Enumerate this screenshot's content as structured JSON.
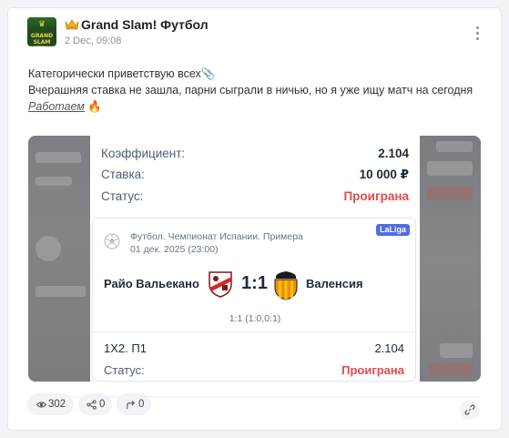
{
  "channel": {
    "name": "Grand Slam! Футбол",
    "date": "2 Dec, 09:08",
    "avatar_text": "GRAND SLAM BETTING"
  },
  "post": {
    "line1": "Категорически приветствую всех📎",
    "line2": "Вчерашняя ставка не зашла, парни сыграли в ничью, но я уже ищу матч на сегодня",
    "line3": "Работаем",
    "line3_emoji": "🔥"
  },
  "slip": {
    "coef_label": "Коэффициент:",
    "coef_value": "2.104",
    "stake_label": "Ставка:",
    "stake_value": "10 000 ₽",
    "status_label": "Статус:",
    "status_value": "Проиграна"
  },
  "match": {
    "league": "Футбол. Чемпионат Испании. Примера",
    "datetime": "01 дек. 2025 (23:00)",
    "badge": "LaLiga",
    "home": "Райо Вальекано",
    "away": "Валенсия",
    "score": "1:1",
    "score_detail": "1:1 (1:0,0:1)",
    "market": "1X2. П1",
    "market_coef": "2.104",
    "status_label": "Статус:",
    "status_value": "Проиграна"
  },
  "footer": {
    "views": "302",
    "shares": "0",
    "forwards": "0"
  },
  "colors": {
    "lost": "#e5484d",
    "badge": "#4d6ce6",
    "label": "#4b5d76"
  }
}
